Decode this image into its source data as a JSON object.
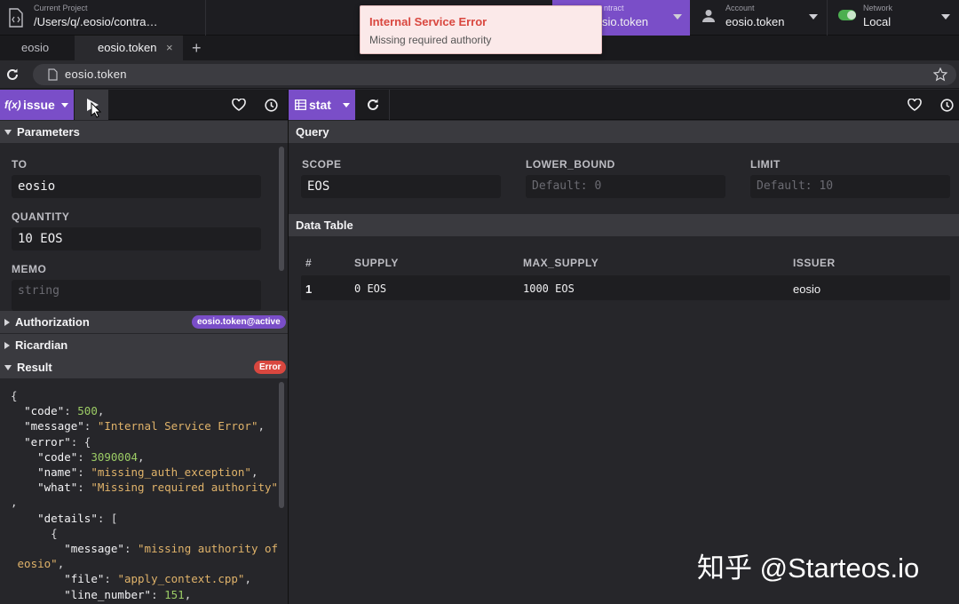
{
  "topbar": {
    "project_label": "Current Project",
    "project_path": "/Users/q/.eosio/contra…",
    "contract_label": "ntract",
    "contract_value": "sio.token",
    "account_label": "Account",
    "account_value": "eosio.token",
    "network_label": "Network",
    "network_value": "Local"
  },
  "tabs": [
    {
      "label": "eosio"
    },
    {
      "label": "eosio.token",
      "close": "×"
    },
    {
      "label": "+"
    }
  ],
  "url": "eosio.token",
  "toast": {
    "title": "Internal Service Error",
    "message": "Missing required authority"
  },
  "left": {
    "action_label": "issue",
    "fx_label": "f(x)",
    "parameters_title": "Parameters",
    "fields": [
      {
        "label": "TO",
        "value": "eosio"
      },
      {
        "label": "QUANTITY",
        "value": "10 EOS"
      },
      {
        "label": "MEMO",
        "placeholder": "string"
      }
    ],
    "authorization_title": "Authorization",
    "authorization_badge": "eosio.token@active",
    "ricardian_title": "Ricardian",
    "result_title": "Result",
    "result_badge": "Error"
  },
  "right": {
    "table_label": "stat",
    "query_title": "Query",
    "query_fields": [
      {
        "label": "SCOPE",
        "value": "EOS"
      },
      {
        "label": "LOWER_BOUND",
        "placeholder": "Default: 0"
      },
      {
        "label": "LIMIT",
        "placeholder": "Default: 10"
      }
    ],
    "data_table_title": "Data Table",
    "columns": [
      "#",
      "SUPPLY",
      "MAX_SUPPLY",
      "ISSUER"
    ],
    "rows": [
      [
        "1",
        "0 EOS",
        "1000 EOS",
        "eosio"
      ]
    ]
  },
  "watermark": "知乎 @Starteos.io",
  "colors": {
    "accent": "#7a4ec8",
    "error": "#d9473f",
    "network_on": "#4caf50"
  }
}
